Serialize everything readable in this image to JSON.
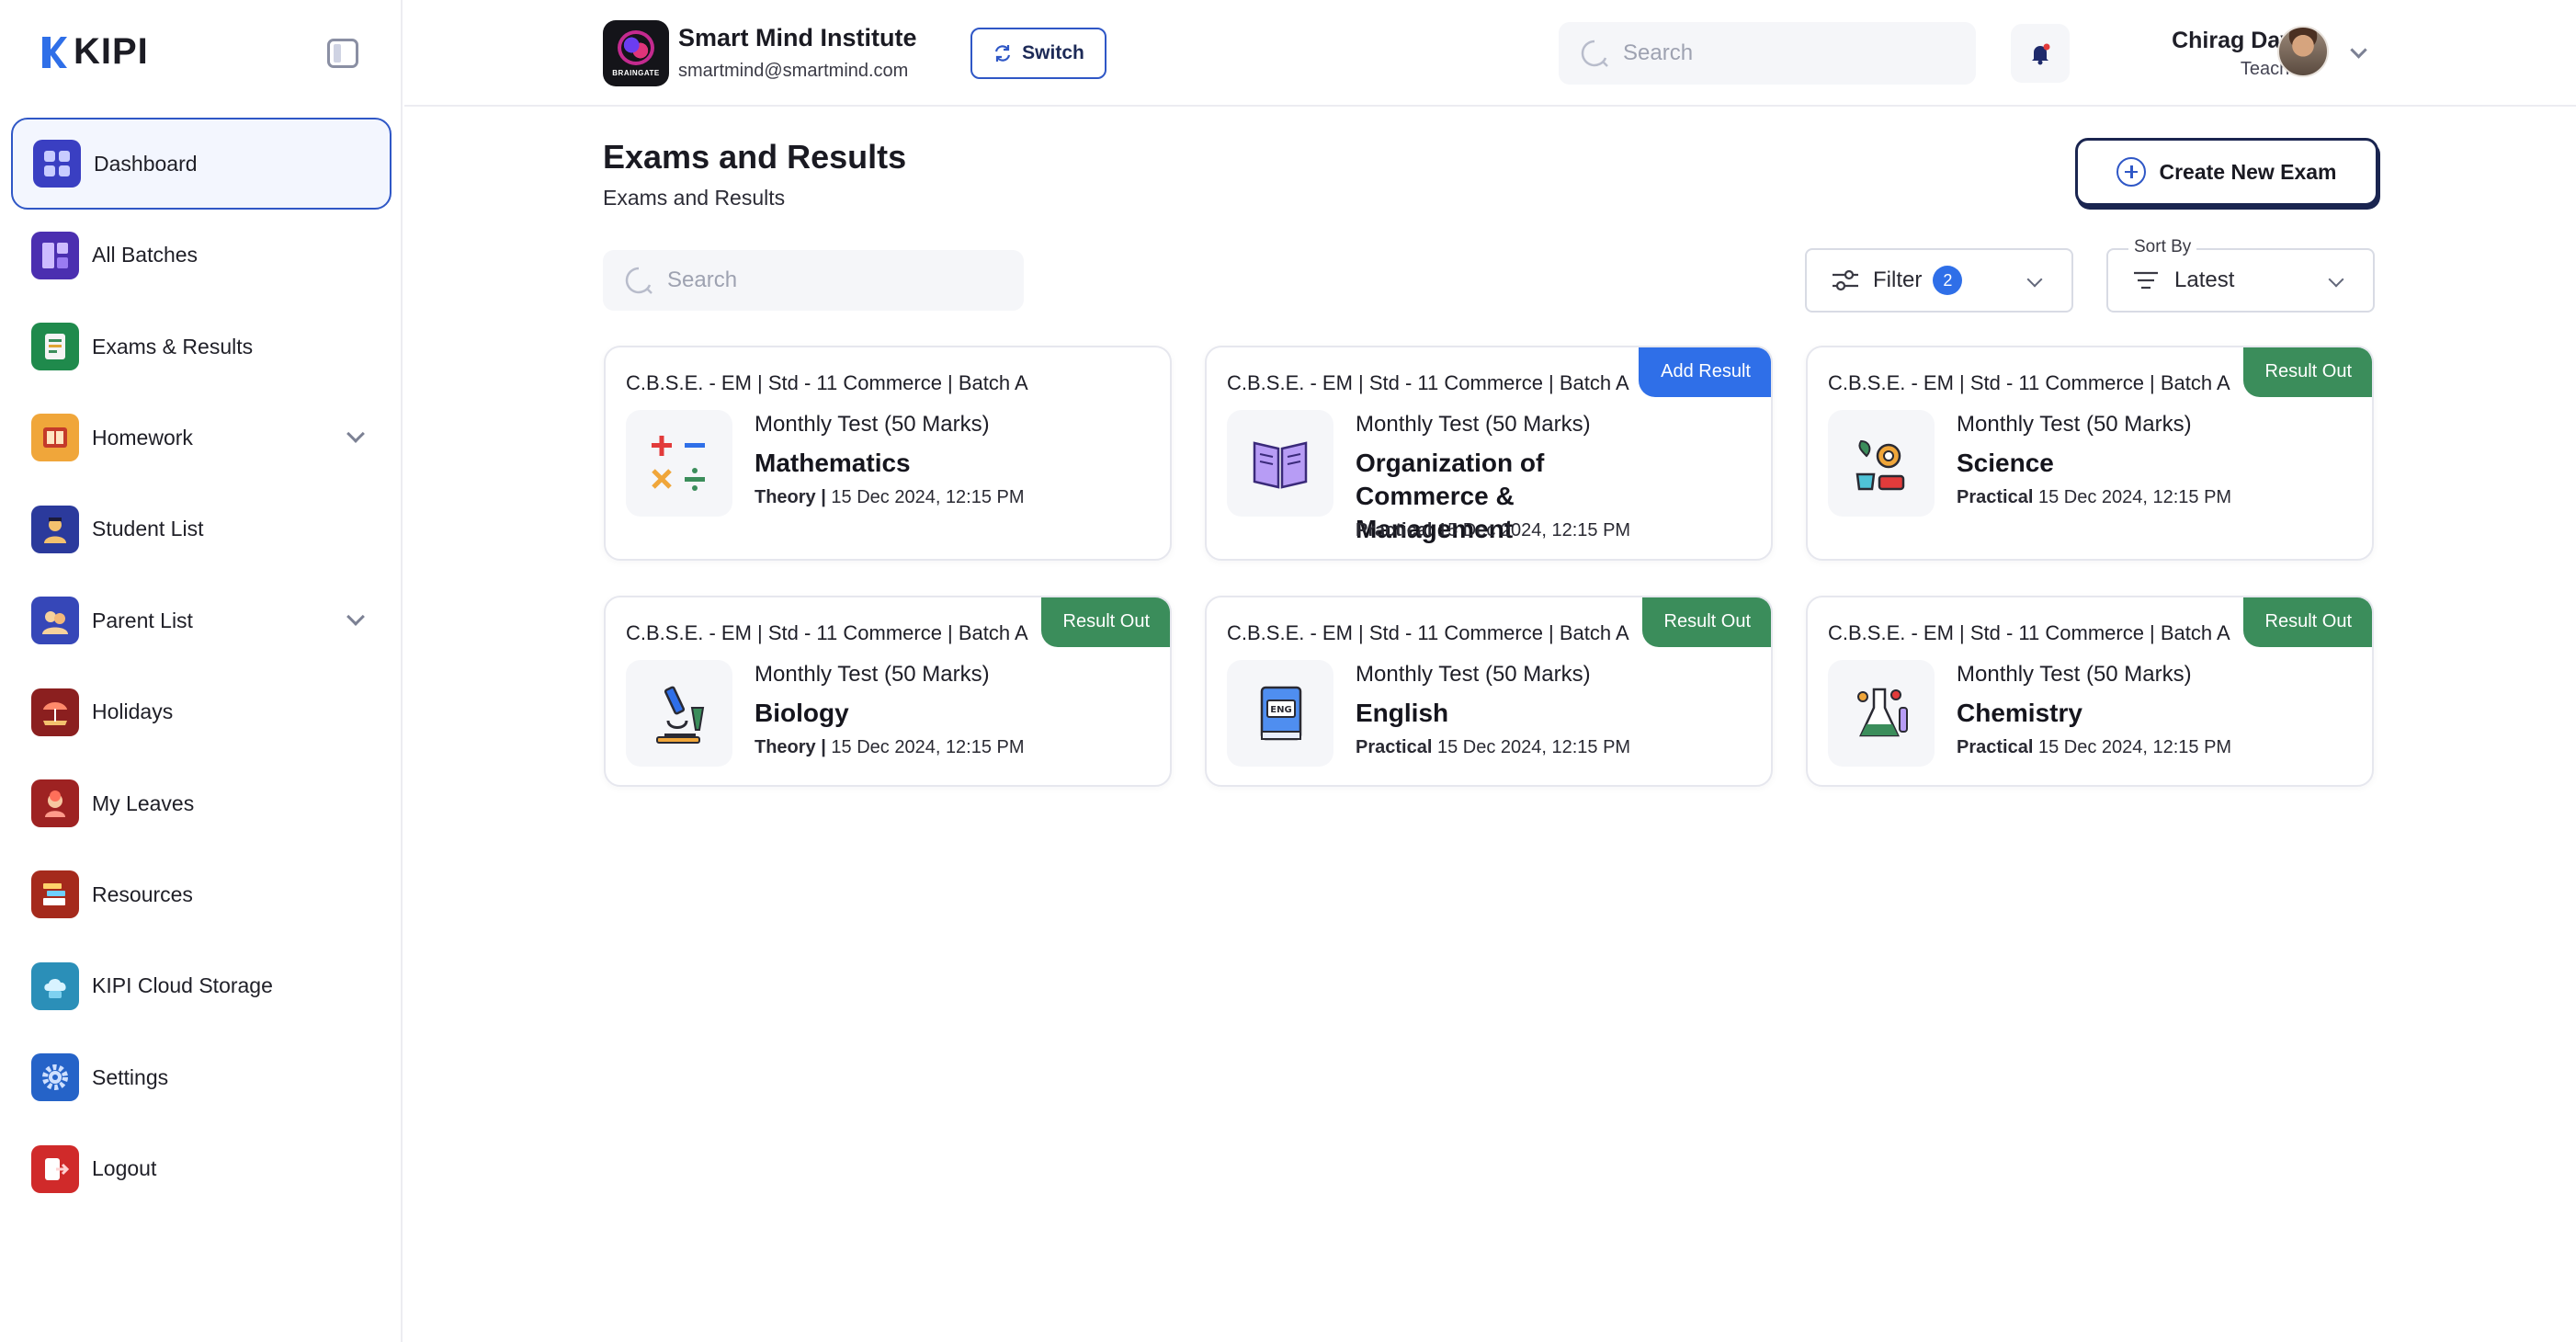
{
  "brand": {
    "name": "KIPI"
  },
  "sidebar": {
    "items": [
      {
        "label": "Dashboard",
        "icon": "dashboard-icon",
        "active": true,
        "color": "#3a3fc2"
      },
      {
        "label": "All Batches",
        "icon": "batches-icon",
        "color": "#4b2fb0"
      },
      {
        "label": "Exams & Results",
        "icon": "exams-icon",
        "color": "#1f8a4c"
      },
      {
        "label": "Homework",
        "icon": "homework-icon",
        "color": "#f0a63a",
        "expandable": true
      },
      {
        "label": "Student List",
        "icon": "student-icon",
        "color": "#2b3a9c"
      },
      {
        "label": "Parent List",
        "icon": "parent-icon",
        "color": "#3647b8",
        "expandable": true
      },
      {
        "label": "Holidays",
        "icon": "holidays-icon",
        "color": "#8b1f1f"
      },
      {
        "label": "My Leaves",
        "icon": "leaves-icon",
        "color": "#9e2222"
      },
      {
        "label": "Resources",
        "icon": "resources-icon",
        "color": "#a52a1c"
      },
      {
        "label": "KIPI Cloud Storage",
        "icon": "cloud-icon",
        "color": "#2b8fb8"
      },
      {
        "label": "Settings",
        "icon": "settings-icon",
        "color": "#2563c8"
      },
      {
        "label": "Logout",
        "icon": "logout-icon",
        "color": "#d02a2a"
      }
    ]
  },
  "header": {
    "institute_name": "Smart Mind Institute",
    "institute_email": "smartmind@smartmind.com",
    "institute_logo_text": "BRAINGATE",
    "switch_label": "Switch",
    "search_placeholder": "Search",
    "user_name": "Chirag Dave",
    "user_role": "Teacher"
  },
  "main": {
    "title": "Exams and Results",
    "subtitle": "Exams and Results",
    "create_label": "Create New Exam",
    "search_placeholder": "Search",
    "filter_label": "Filter",
    "filter_count": "2",
    "sort_legend": "Sort By",
    "sort_value": "Latest"
  },
  "cards": [
    {
      "batch": "C.B.S.E. - EM | Std - 11 Commerce | Batch A",
      "test": "Monthly Test (50 Marks)",
      "subject": "Mathematics",
      "mode": "Theory |",
      "date": "15 Dec 2024, 12:15 PM",
      "badge": "",
      "icon": "math-icon"
    },
    {
      "batch": "C.B.S.E. - EM | Std - 11 Commerce | Batch A",
      "test": "Monthly Test (50 Marks)",
      "subject": "Organization of Commerce & Management",
      "mode": "Practical",
      "date": "15 Dec 2024, 12:15 PM",
      "badge": "Add Result",
      "icon": "book-icon"
    },
    {
      "batch": "C.B.S.E. - EM | Std - 11 Commerce | Batch A",
      "test": "Monthly Test (50 Marks)",
      "subject": "Science",
      "mode": "Practical",
      "date": "15 Dec 2024, 12:15 PM",
      "badge": "Result Out",
      "icon": "science-icon"
    },
    {
      "batch": "C.B.S.E. - EM | Std - 11 Commerce | Batch A",
      "test": "Monthly Test (50 Marks)",
      "subject": "Biology",
      "mode": "Theory |",
      "date": "15 Dec 2024, 12:15 PM",
      "badge": "Result Out",
      "icon": "microscope-icon"
    },
    {
      "batch": "C.B.S.E. - EM | Std - 11 Commerce | Batch A",
      "test": "Monthly Test (50 Marks)",
      "subject": "English",
      "mode": "Practical",
      "date": "15 Dec 2024, 12:15 PM",
      "badge": "Result Out",
      "icon": "english-book-icon"
    },
    {
      "batch": "C.B.S.E. - EM | Std - 11 Commerce | Batch A",
      "test": "Monthly Test (50 Marks)",
      "subject": "Chemistry",
      "mode": "Practical",
      "date": "15 Dec 2024, 12:15 PM",
      "badge": "Result Out",
      "icon": "flask-icon"
    }
  ],
  "colors": {
    "accent": "#2f57c6",
    "result_out": "#3b8d5b",
    "add_result": "#2f6fe8"
  }
}
